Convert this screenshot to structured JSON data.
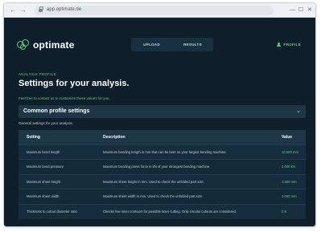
{
  "browser": {
    "url": "app.optimate.de",
    "nav_back": "←",
    "nav_forward": "→",
    "win_min": "—",
    "win_max": "☐",
    "win_close": "✕"
  },
  "app": {
    "logo_text": "optimate",
    "tabs": [
      "UPLOAD",
      "RESULTS"
    ],
    "profile_label": "PROFILE",
    "eyebrow": "ANALYSIS PROFILE",
    "title": "Settings for your analysis.",
    "contact_text": "Feel free to contact us to customize these values for you.",
    "section": {
      "title": "Common profile settings",
      "chevron": "⌄",
      "description": "General settings for your analysis."
    },
    "table": {
      "headers": [
        "Setting",
        "Description",
        "Value"
      ],
      "rows": [
        [
          "Maximum bend length",
          "Maximum bending length in mm that can be bent on your largest bending machine.",
          "10.000 mm"
        ],
        [
          "Maximum bend pressure",
          "Maximum bending press force in kN of your strongest bending machine.",
          "2.000 kN"
        ],
        [
          "Maximum sheet height",
          "Maximum sheet height in mm. Used to check the unfolded part size.",
          "1.500 mm"
        ],
        [
          "Maximum sheet width",
          "Maximum sheet width in mm. Used to check the unfolded part size.",
          "3.000 mm"
        ],
        [
          "Thickness to cutout diameter ratio",
          "Checks few inner contours for possible laser cutting. Only circular cutouts are considered.",
          "0.8"
        ]
      ]
    }
  },
  "colors": {
    "background": "#0e1f2b",
    "accent": "#5dd17c",
    "panel": "#1d3747"
  }
}
